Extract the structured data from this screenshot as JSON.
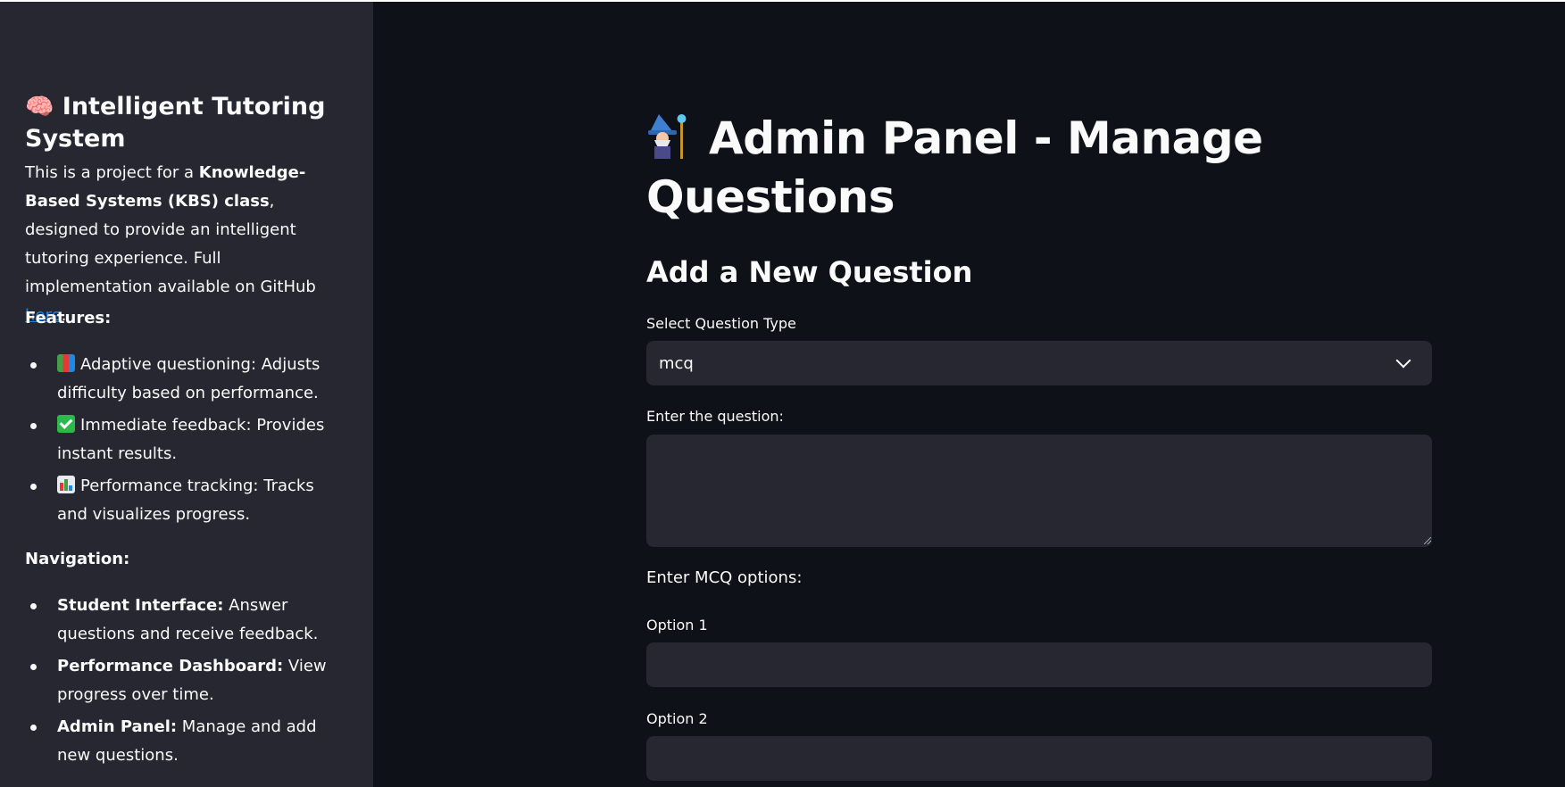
{
  "sidebar": {
    "title_emoji": "🧠",
    "title": "Intelligent Tutoring System",
    "intro": {
      "prefix": "This is a project for a ",
      "bold": "Knowledge-Based Systems (KBS) class",
      "middle": ", designed to provide an intelligent tutoring experience. Full implementation available on GitHub ",
      "link": "here",
      "suffix": "."
    },
    "features_heading": "Features:",
    "features": [
      {
        "icon": "books-icon",
        "text": "Adaptive questioning: Adjusts difficulty based on performance."
      },
      {
        "icon": "check-mark-icon",
        "text": "Immediate feedback: Provides instant results."
      },
      {
        "icon": "bar-chart-icon",
        "text": "Performance tracking: Tracks and visualizes progress."
      }
    ],
    "navigation_heading": "Navigation:",
    "navigation": [
      {
        "bold": "Student Interface:",
        "text": " Answer questions and receive feedback."
      },
      {
        "bold": "Performance Dashboard:",
        "text": " View progress over time."
      },
      {
        "bold": "Admin Panel:",
        "text": " Manage and add new questions."
      }
    ]
  },
  "main": {
    "page_title": "Admin Panel - Manage Questions",
    "section_title": "Add a New Question",
    "question_type_label": "Select Question Type",
    "question_type_value": "mcq",
    "question_label": "Enter the question:",
    "question_value": "",
    "mcq_heading": "Enter MCQ options:",
    "option1_label": "Option 1",
    "option1_value": "",
    "option2_label": "Option 2",
    "option2_value": ""
  },
  "colors": {
    "background": "#0e1117",
    "sidebar": "#262730",
    "input": "#262730",
    "link": "#1c83e1",
    "text": "#fafafa"
  }
}
